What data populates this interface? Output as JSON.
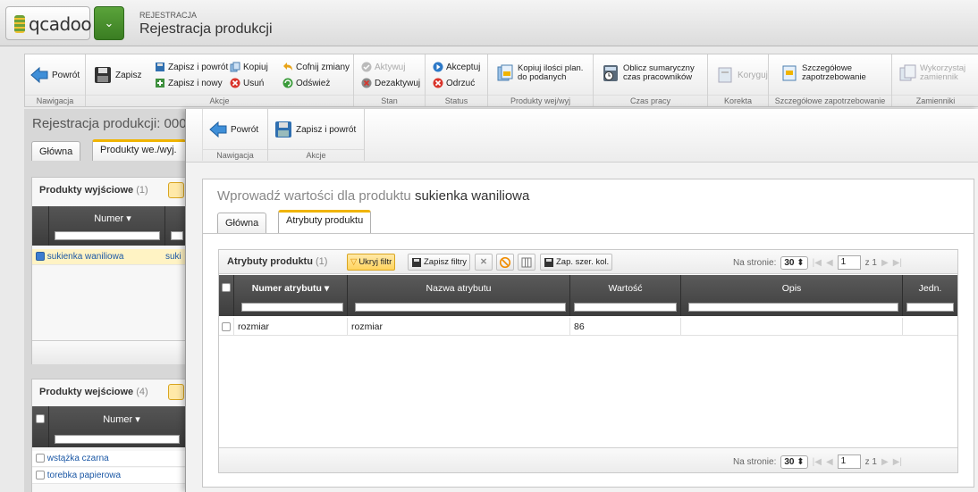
{
  "header": {
    "logo": "qcadoo",
    "breadcrumb_small": "REJESTRACJA",
    "breadcrumb_title": "Rejestracja produkcji"
  },
  "toolbar": {
    "navigation": {
      "back": "Powrót",
      "label": "Nawigacja"
    },
    "actions": {
      "save": "Zapisz",
      "save_back": "Zapisz i powrót",
      "save_new": "Zapisz i nowy",
      "copy": "Kopiuj",
      "delete": "Usuń",
      "undo": "Cofnij zmiany",
      "refresh": "Odśwież",
      "label": "Akcje"
    },
    "state": {
      "activate": "Aktywuj",
      "deactivate": "Dezaktywuj",
      "label": "Stan"
    },
    "status": {
      "accept": "Akceptuj",
      "reject": "Odrzuć",
      "label": "Status"
    },
    "products_io": {
      "copy_planned": "Kopiuj ilości plan. do podanych",
      "label": "Produkty wej/wyj"
    },
    "work_time": {
      "calc": "Oblicz sumaryczny czas pracowników",
      "label": "Czas pracy"
    },
    "correction": {
      "correct": "Koryguj",
      "label": "Korekta"
    },
    "detailed": {
      "btn": "Szczegółowe zapotrzebowanie",
      "label": "Szczegółowe zapotrzebowanie"
    },
    "replacements": {
      "btn": "Wykorzystaj zamiennik",
      "label": "Zamienniki"
    }
  },
  "background_page": {
    "title": "Rejestracja produkcji: 000",
    "tabs": [
      "Główna",
      "Produkty we./wyj."
    ],
    "output": {
      "title": "Produkty wyjściowe",
      "count": "(1)",
      "column": "Numer",
      "rows": [
        {
          "number": "sukienka waniliowa",
          "name": "suki"
        }
      ]
    },
    "input": {
      "title": "Produkty wejściowe",
      "count": "(4)",
      "column": "Numer",
      "rows": [
        "wstążka czarna",
        "torebka papierowa"
      ]
    }
  },
  "modal": {
    "toolbar": {
      "back": "Powrót",
      "save_back": "Zapisz i powrót",
      "nav_label": "Nawigacja",
      "actions_label": "Akcje"
    },
    "title_prefix": "Wprowadź wartości dla produktu",
    "title_product": "sukienka waniliowa",
    "tabs": [
      "Główna",
      "Atrybuty produktu"
    ],
    "grid": {
      "title": "Atrybuty produktu",
      "count": "(1)",
      "hide_filter": "Ukryj filtr",
      "save_filters": "Zapisz filtry",
      "save_widths": "Zap. szer. kol.",
      "per_page_label": "Na stronie:",
      "per_page": "30",
      "page": "1",
      "of_pages": "z 1",
      "columns": [
        "Numer atrybutu",
        "Nazwa atrybutu",
        "Wartość",
        "Opis",
        "Jedn."
      ],
      "rows": [
        {
          "number": "rozmiar",
          "name": "rozmiar",
          "value": "86",
          "desc": "",
          "unit": ""
        }
      ]
    }
  }
}
